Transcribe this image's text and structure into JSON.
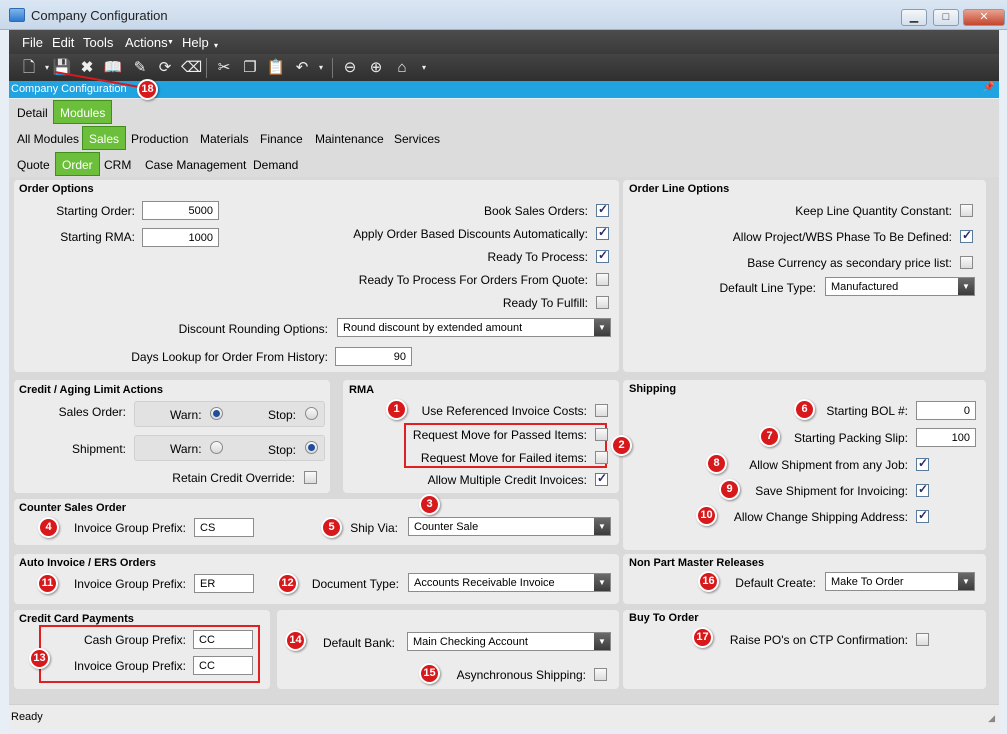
{
  "window": {
    "title": "Company Configuration",
    "min": "▁",
    "max": "□",
    "close": "✕"
  },
  "menu": [
    "File",
    "Edit",
    "Tools",
    "Actions",
    "Help"
  ],
  "toolbar_icons": [
    "new-icon",
    "save-icon",
    "delete-icon",
    "book-icon",
    "attach-icon",
    "refresh-icon",
    "clear-icon",
    "cut-icon",
    "copy-icon",
    "paste-icon",
    "undo-icon",
    "back-icon",
    "forward-icon",
    "home-icon"
  ],
  "panel_title": "Company Configuration",
  "tabs1": [
    "Detail",
    "Modules"
  ],
  "tabs2": [
    "All Modules",
    "Sales",
    "Production",
    "Materials",
    "Finance",
    "Maintenance",
    "Services"
  ],
  "tabs3": [
    "Quote",
    "Order",
    "CRM",
    "Case Management",
    "Demand"
  ],
  "order_options": {
    "title": "Order Options",
    "starting_order_label": "Starting Order:",
    "starting_order": "5000",
    "starting_rma_label": "Starting RMA:",
    "starting_rma": "1000",
    "book_sales_orders": "Book Sales Orders:",
    "apply_discounts": "Apply Order Based Discounts Automatically:",
    "ready_to_process": "Ready To Process:",
    "ready_from_quote": "Ready To Process For Orders From Quote:",
    "ready_to_fulfill": "Ready To Fulfill:",
    "discount_rounding_label": "Discount Rounding Options:",
    "discount_rounding": "Round discount by extended amount",
    "days_lookup_label": "Days Lookup for Order From History:",
    "days_lookup": "90"
  },
  "order_line": {
    "title": "Order Line Options",
    "keep_qty": "Keep Line Quantity Constant:",
    "allow_project": "Allow Project/WBS Phase To Be Defined:",
    "base_currency": "Base Currency as secondary price list:",
    "default_type_label": "Default Line Type:",
    "default_type": "Manufactured"
  },
  "credit": {
    "title": "Credit / Aging Limit Actions",
    "sales_order": "Sales Order:",
    "shipment": "Shipment:",
    "warn": "Warn:",
    "stop": "Stop:",
    "retain": "Retain Credit Override:"
  },
  "rma": {
    "title": "RMA",
    "use_ref": "Use Referenced Invoice Costs:",
    "passed": "Request Move for Passed Items:",
    "failed": "Request Move for Failed items:",
    "allow_multiple": "Allow Multiple Credit Invoices:"
  },
  "shipping": {
    "title": "Shipping",
    "starting_bol_label": "Starting BOL #:",
    "starting_bol": "0",
    "packing_label": "Starting Packing Slip:",
    "packing": "100",
    "allow_any_job": "Allow Shipment from any Job:",
    "save_invoicing": "Save Shipment for Invoicing:",
    "allow_change": "Allow Change Shipping Address:"
  },
  "counter": {
    "title": "Counter Sales Order",
    "igp_label": "Invoice Group Prefix:",
    "igp": "CS",
    "ship_via_label": "Ship Via:",
    "ship_via": "Counter Sale"
  },
  "auto_invoice": {
    "title": "Auto Invoice / ERS Orders",
    "igp_label": "Invoice Group Prefix:",
    "igp": "ER",
    "doc_type_label": "Document Type:",
    "doc_type": "Accounts Receivable Invoice"
  },
  "non_part": {
    "title": "Non Part Master Releases",
    "default_create_label": "Default Create:",
    "default_create": "Make To Order"
  },
  "credit_card": {
    "title": "Credit Card Payments",
    "cash_label": "Cash Group Prefix:",
    "cash": "CC",
    "igp_label": "Invoice Group Prefix:",
    "igp": "CC"
  },
  "bank": {
    "default_bank_label": "Default Bank:",
    "default_bank": "Main Checking Account",
    "async": "Asynchronous Shipping:"
  },
  "buy_to_order": {
    "title": "Buy To Order",
    "raise_po": "Raise PO's on CTP Confirmation:"
  },
  "callouts": [
    "1",
    "2",
    "3",
    "4",
    "5",
    "6",
    "7",
    "8",
    "9",
    "10",
    "11",
    "12",
    "13",
    "14",
    "15",
    "16",
    "17",
    "18"
  ],
  "status": "Ready",
  "colors": {
    "accent_tab": "#6cbf3a",
    "blue_bar": "#1fa3e1",
    "callout": "#d7191c"
  }
}
